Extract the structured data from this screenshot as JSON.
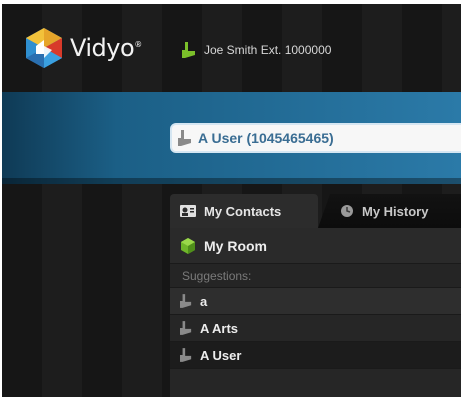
{
  "header": {
    "brand": "Vidyo",
    "trademark": "®",
    "user_status": "Joe Smith Ext. 1000000"
  },
  "search": {
    "value": "A User (1045465465)"
  },
  "tabs": [
    {
      "label": "My Contacts",
      "icon": "contacts-card-icon",
      "active": true
    },
    {
      "label": "My History",
      "icon": "history-icon",
      "active": false
    }
  ],
  "list": {
    "my_room": "My Room",
    "suggestions_header": "Suggestions:",
    "items": [
      {
        "label": "a"
      },
      {
        "label": "A Arts"
      },
      {
        "label": "A User"
      }
    ]
  },
  "colors": {
    "status_online": "#7bbf2a",
    "status_offline": "#8a8a8a",
    "accent_blue": "#2b7aa8",
    "room_green": "#6fb62a"
  }
}
